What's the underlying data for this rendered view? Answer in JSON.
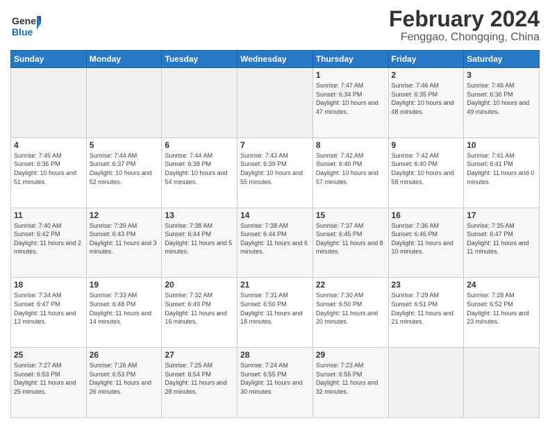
{
  "header": {
    "logo_general": "General",
    "logo_blue": "Blue",
    "title": "February 2024",
    "location": "Fenggao, Chongqing, China"
  },
  "days_of_week": [
    "Sunday",
    "Monday",
    "Tuesday",
    "Wednesday",
    "Thursday",
    "Friday",
    "Saturday"
  ],
  "weeks": [
    [
      {
        "day": "",
        "info": ""
      },
      {
        "day": "",
        "info": ""
      },
      {
        "day": "",
        "info": ""
      },
      {
        "day": "",
        "info": ""
      },
      {
        "day": "1",
        "info": "Sunrise: 7:47 AM\nSunset: 6:34 PM\nDaylight: 10 hours\nand 47 minutes."
      },
      {
        "day": "2",
        "info": "Sunrise: 7:46 AM\nSunset: 6:35 PM\nDaylight: 10 hours\nand 48 minutes."
      },
      {
        "day": "3",
        "info": "Sunrise: 7:46 AM\nSunset: 6:36 PM\nDaylight: 10 hours\nand 49 minutes."
      }
    ],
    [
      {
        "day": "4",
        "info": "Sunrise: 7:45 AM\nSunset: 6:36 PM\nDaylight: 10 hours\nand 51 minutes."
      },
      {
        "day": "5",
        "info": "Sunrise: 7:44 AM\nSunset: 6:37 PM\nDaylight: 10 hours\nand 52 minutes."
      },
      {
        "day": "6",
        "info": "Sunrise: 7:44 AM\nSunset: 6:38 PM\nDaylight: 10 hours\nand 54 minutes."
      },
      {
        "day": "7",
        "info": "Sunrise: 7:43 AM\nSunset: 6:39 PM\nDaylight: 10 hours\nand 55 minutes."
      },
      {
        "day": "8",
        "info": "Sunrise: 7:42 AM\nSunset: 6:40 PM\nDaylight: 10 hours\nand 57 minutes."
      },
      {
        "day": "9",
        "info": "Sunrise: 7:42 AM\nSunset: 6:40 PM\nDaylight: 10 hours\nand 58 minutes."
      },
      {
        "day": "10",
        "info": "Sunrise: 7:41 AM\nSunset: 6:41 PM\nDaylight: 11 hours\nand 0 minutes."
      }
    ],
    [
      {
        "day": "11",
        "info": "Sunrise: 7:40 AM\nSunset: 6:42 PM\nDaylight: 11 hours\nand 2 minutes."
      },
      {
        "day": "12",
        "info": "Sunrise: 7:39 AM\nSunset: 6:43 PM\nDaylight: 11 hours\nand 3 minutes."
      },
      {
        "day": "13",
        "info": "Sunrise: 7:38 AM\nSunset: 6:44 PM\nDaylight: 11 hours\nand 5 minutes."
      },
      {
        "day": "14",
        "info": "Sunrise: 7:38 AM\nSunset: 6:44 PM\nDaylight: 11 hours\nand 6 minutes."
      },
      {
        "day": "15",
        "info": "Sunrise: 7:37 AM\nSunset: 6:45 PM\nDaylight: 11 hours\nand 8 minutes."
      },
      {
        "day": "16",
        "info": "Sunrise: 7:36 AM\nSunset: 6:46 PM\nDaylight: 11 hours\nand 10 minutes."
      },
      {
        "day": "17",
        "info": "Sunrise: 7:35 AM\nSunset: 6:47 PM\nDaylight: 11 hours\nand 11 minutes."
      }
    ],
    [
      {
        "day": "18",
        "info": "Sunrise: 7:34 AM\nSunset: 6:47 PM\nDaylight: 11 hours\nand 13 minutes."
      },
      {
        "day": "19",
        "info": "Sunrise: 7:33 AM\nSunset: 6:48 PM\nDaylight: 11 hours\nand 14 minutes."
      },
      {
        "day": "20",
        "info": "Sunrise: 7:32 AM\nSunset: 6:49 PM\nDaylight: 11 hours\nand 16 minutes."
      },
      {
        "day": "21",
        "info": "Sunrise: 7:31 AM\nSunset: 6:50 PM\nDaylight: 11 hours\nand 18 minutes."
      },
      {
        "day": "22",
        "info": "Sunrise: 7:30 AM\nSunset: 6:50 PM\nDaylight: 11 hours\nand 20 minutes."
      },
      {
        "day": "23",
        "info": "Sunrise: 7:29 AM\nSunset: 6:51 PM\nDaylight: 11 hours\nand 21 minutes."
      },
      {
        "day": "24",
        "info": "Sunrise: 7:28 AM\nSunset: 6:52 PM\nDaylight: 11 hours\nand 23 minutes."
      }
    ],
    [
      {
        "day": "25",
        "info": "Sunrise: 7:27 AM\nSunset: 6:53 PM\nDaylight: 11 hours\nand 25 minutes."
      },
      {
        "day": "26",
        "info": "Sunrise: 7:26 AM\nSunset: 6:53 PM\nDaylight: 11 hours\nand 26 minutes."
      },
      {
        "day": "27",
        "info": "Sunrise: 7:25 AM\nSunset: 6:54 PM\nDaylight: 11 hours\nand 28 minutes."
      },
      {
        "day": "28",
        "info": "Sunrise: 7:24 AM\nSunset: 6:55 PM\nDaylight: 11 hours\nand 30 minutes."
      },
      {
        "day": "29",
        "info": "Sunrise: 7:23 AM\nSunset: 6:55 PM\nDaylight: 11 hours\nand 32 minutes."
      },
      {
        "day": "",
        "info": ""
      },
      {
        "day": "",
        "info": ""
      }
    ]
  ]
}
